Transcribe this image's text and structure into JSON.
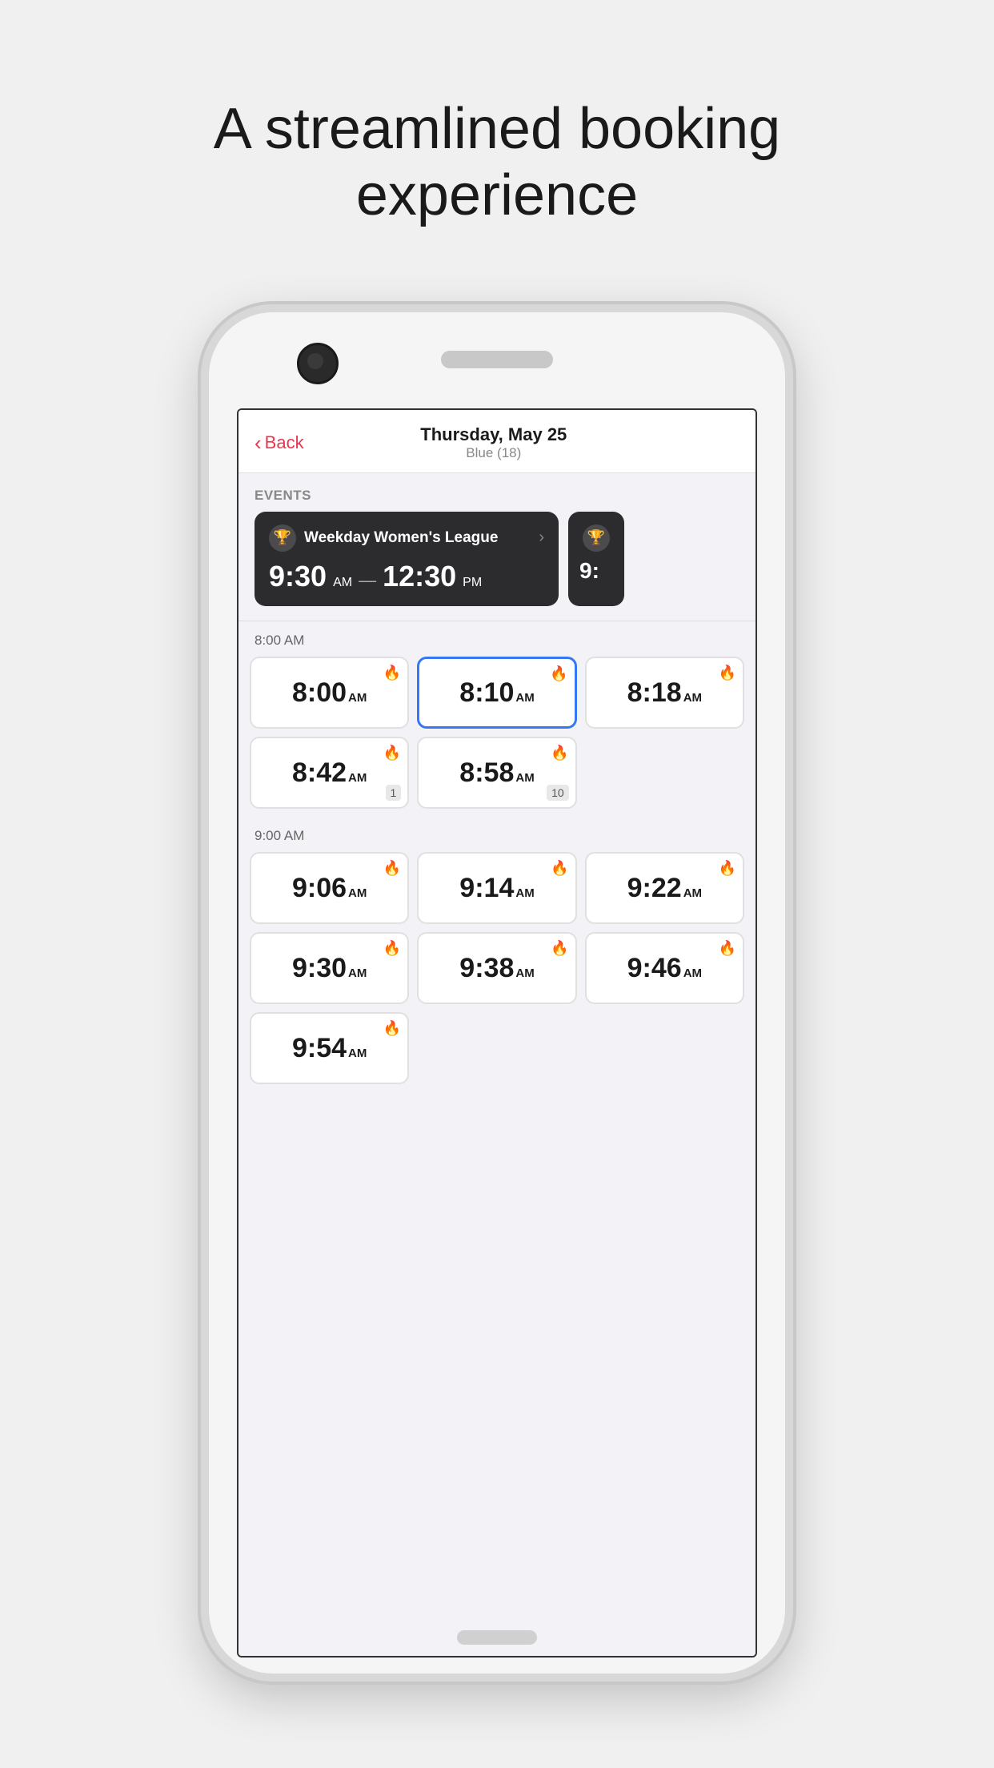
{
  "page": {
    "tagline": "A streamlined booking experience"
  },
  "nav": {
    "back_label": "Back",
    "title": "Thursday, May 25",
    "subtitle": "Blue (18)"
  },
  "events_section": {
    "label": "EVENTS",
    "cards": [
      {
        "icon": "🏆",
        "name": "Weekday Women's League",
        "start_time": "9:30",
        "start_ampm": "AM",
        "end_time": "12:30",
        "end_ampm": "PM"
      },
      {
        "icon": "🏆",
        "name": "",
        "start_time": "9:",
        "start_ampm": "",
        "end_time": "",
        "end_ampm": ""
      }
    ]
  },
  "time_sections": [
    {
      "header": "8:00 AM",
      "slots": [
        {
          "time": "8:00",
          "ampm": "AM",
          "flame": true,
          "badge": null,
          "selected": false
        },
        {
          "time": "8:10",
          "ampm": "AM",
          "flame": true,
          "badge": null,
          "selected": true
        },
        {
          "time": "8:18",
          "ampm": "AM",
          "flame": true,
          "badge": null,
          "selected": false
        },
        {
          "time": "8:42",
          "ampm": "AM",
          "flame": true,
          "badge": "1",
          "selected": false
        },
        {
          "time": "8:58",
          "ampm": "AM",
          "flame": true,
          "badge": "10",
          "selected": false
        }
      ]
    },
    {
      "header": "9:00 AM",
      "slots": [
        {
          "time": "9:06",
          "ampm": "AM",
          "flame": true,
          "badge": null,
          "selected": false
        },
        {
          "time": "9:14",
          "ampm": "AM",
          "flame": true,
          "badge": null,
          "selected": false
        },
        {
          "time": "9:22",
          "ampm": "AM",
          "flame": true,
          "badge": null,
          "selected": false
        },
        {
          "time": "9:30",
          "ampm": "AM",
          "flame": true,
          "badge": null,
          "selected": false
        },
        {
          "time": "9:38",
          "ampm": "AM",
          "flame": true,
          "badge": null,
          "selected": false
        },
        {
          "time": "9:46",
          "ampm": "AM",
          "flame": true,
          "badge": null,
          "selected": false
        },
        {
          "time": "9:54",
          "ampm": "AM",
          "flame": true,
          "badge": null,
          "selected": false
        }
      ]
    }
  ],
  "colors": {
    "accent_red": "#e8384f",
    "accent_blue": "#3478f6",
    "event_bg": "#2c2c2e",
    "flame_color": "#e8384f"
  },
  "icons": {
    "back": "‹",
    "trophy": "🏆",
    "flame": "🔥",
    "arrow_right": "›"
  }
}
